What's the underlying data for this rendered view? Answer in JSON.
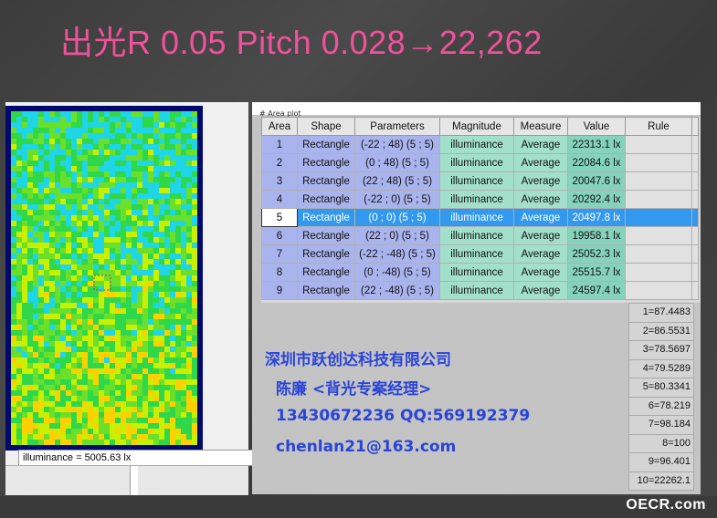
{
  "slide": {
    "title": "出光R 0.05 Pitch 0.028→22,262"
  },
  "viewer": {
    "status_text": "illuminance = 5005.63 lx",
    "header_text": "# Area plot"
  },
  "table": {
    "headers": [
      "Area",
      "Shape",
      "Parameters",
      "Magnitude",
      "Measure",
      "Value",
      "Rule"
    ],
    "selected_row": 5,
    "rows": [
      {
        "area": "1",
        "shape": "Rectangle",
        "params": "(-22 ; 48) (5 ; 5)",
        "magnitude": "illuminance",
        "measure": "Average",
        "value": "22313.1 lx"
      },
      {
        "area": "2",
        "shape": "Rectangle",
        "params": "(0 ; 48) (5 ; 5)",
        "magnitude": "illuminance",
        "measure": "Average",
        "value": "22084.6 lx"
      },
      {
        "area": "3",
        "shape": "Rectangle",
        "params": "(22 ; 48) (5 ; 5)",
        "magnitude": "illuminance",
        "measure": "Average",
        "value": "20047.6 lx"
      },
      {
        "area": "4",
        "shape": "Rectangle",
        "params": "(-22 ; 0) (5 ; 5)",
        "magnitude": "illuminance",
        "measure": "Average",
        "value": "20292.4 lx"
      },
      {
        "area": "5",
        "shape": "Rectangle",
        "params": "(0 ; 0) (5 ; 5)",
        "magnitude": "illuminance",
        "measure": "Average",
        "value": "20497.8 lx"
      },
      {
        "area": "6",
        "shape": "Rectangle",
        "params": "(22 ; 0) (5 ; 5)",
        "magnitude": "illuminance",
        "measure": "Average",
        "value": "19958.1 lx"
      },
      {
        "area": "7",
        "shape": "Rectangle",
        "params": "(-22 ; -48) (5 ; 5)",
        "magnitude": "illuminance",
        "measure": "Average",
        "value": "25052.3 lx"
      },
      {
        "area": "8",
        "shape": "Rectangle",
        "params": "(0 ; -48) (5 ; 5)",
        "magnitude": "illuminance",
        "measure": "Average",
        "value": "25515.7 lx"
      },
      {
        "area": "9",
        "shape": "Rectangle",
        "params": "(22 ; -48) (5 ; 5)",
        "magnitude": "illuminance",
        "measure": "Average",
        "value": "24597.4 lx"
      }
    ]
  },
  "ratios": [
    "1=87.4483",
    "2=86.5531",
    "3=78.5697",
    "4=79.5289",
    "5=80.3341",
    "6=78.219",
    "7=98.184",
    "8=100",
    "9=96.401",
    "10=22262.1"
  ],
  "contact": {
    "company": "深圳市跃创达科技有限公司",
    "person": "陈廉 <背光专案经理>",
    "phone": "13430672236  QQ:569192379",
    "email": "chenlan21@163.com"
  },
  "watermark": "OECR.com",
  "colors": {
    "title": "#f0529a",
    "contact": "#2a44d8",
    "selection": "#3399ee",
    "param_cell": "#a9b4ee",
    "magnitude_cell": "#a3e0cc"
  }
}
